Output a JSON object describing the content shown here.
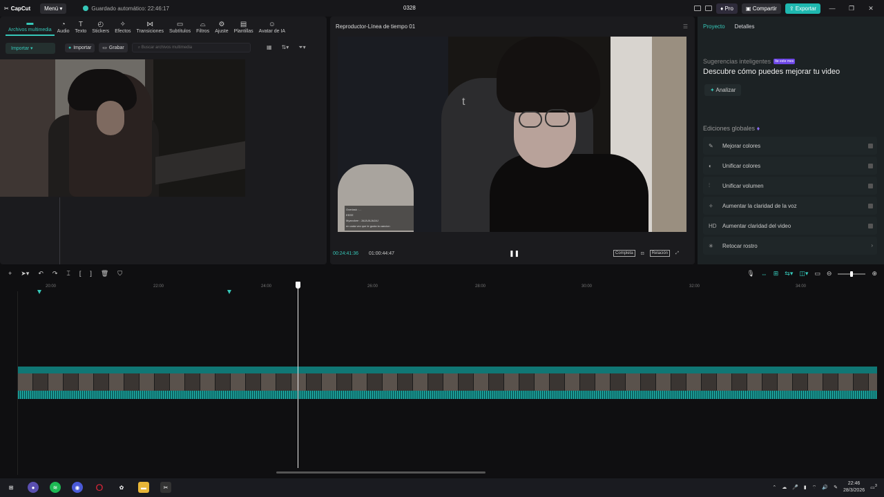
{
  "app": {
    "logo": "CapCut",
    "menu_label": "Menú",
    "autosave": "Guardado automático: 22:46:17",
    "project_title": "0328",
    "pro_label": "Pro",
    "share_label": "Compartir",
    "export_label": "Exportar"
  },
  "top_tabs": [
    {
      "label": "Archivos multimedia",
      "icon": "media-icon"
    },
    {
      "label": "Audio",
      "icon": "audio-icon"
    },
    {
      "label": "Texto",
      "icon": "text-icon"
    },
    {
      "label": "Stickers",
      "icon": "sticker-icon"
    },
    {
      "label": "Efectos",
      "icon": "effects-icon"
    },
    {
      "label": "Transiciones",
      "icon": "transitions-icon"
    },
    {
      "label": "Subtítulos",
      "icon": "subtitles-icon"
    },
    {
      "label": "Filtros",
      "icon": "filters-icon"
    },
    {
      "label": "Ajuste",
      "icon": "adjust-icon"
    },
    {
      "label": "Plantillas",
      "icon": "templates-icon"
    },
    {
      "label": "Avatar de IA",
      "icon": "avatar-icon"
    }
  ],
  "media": {
    "sidebar_import": "Importar",
    "import_btn": "Importar",
    "record_btn": "Grabar",
    "search_placeholder": "Buscar archivos multimedia"
  },
  "player": {
    "title": "Reproductor-Línea de tiempo 01",
    "current_time": "00:24:41:36",
    "total_time": "01:00:44:47",
    "full_label": "Completa",
    "ratio_label": "Relación",
    "chat": [
      "Overlask : ...",
      "EEEE",
      "Myanckee : JAJAJAJAJAJ",
      "en cada vez que le gusta la cancion"
    ],
    "overlay_letter": "t"
  },
  "right": {
    "tab_project": "Proyecto",
    "tab_details": "Detalles",
    "suggest_title": "Sugerencias inteligentes",
    "badge": "Ite este mes",
    "headline": "Descubre cómo puedes mejorar tu video",
    "analyze": "Analizar",
    "global_title": "Ediciones globales",
    "items": [
      {
        "label": "Mejorar colores",
        "icon": "color-icon"
      },
      {
        "label": "Unificar colores",
        "icon": "unify-color-icon"
      },
      {
        "label": "Unificar volumen",
        "icon": "volume-icon"
      },
      {
        "label": "Aumentar la claridad de la voz",
        "icon": "voice-icon"
      },
      {
        "label": "Aumentar claridad del video",
        "icon": "hd-icon",
        "glyph": "HD"
      },
      {
        "label": "Retocar rostro",
        "icon": "face-icon"
      }
    ]
  },
  "timeline": {
    "ticks": [
      "20:00",
      "22:00",
      "24:00",
      "26:00",
      "28:00",
      "30:00",
      "32:00",
      "34:00"
    ]
  },
  "taskbar": {
    "time": "22:46",
    "date": "28/3/2026",
    "notif": "3"
  }
}
